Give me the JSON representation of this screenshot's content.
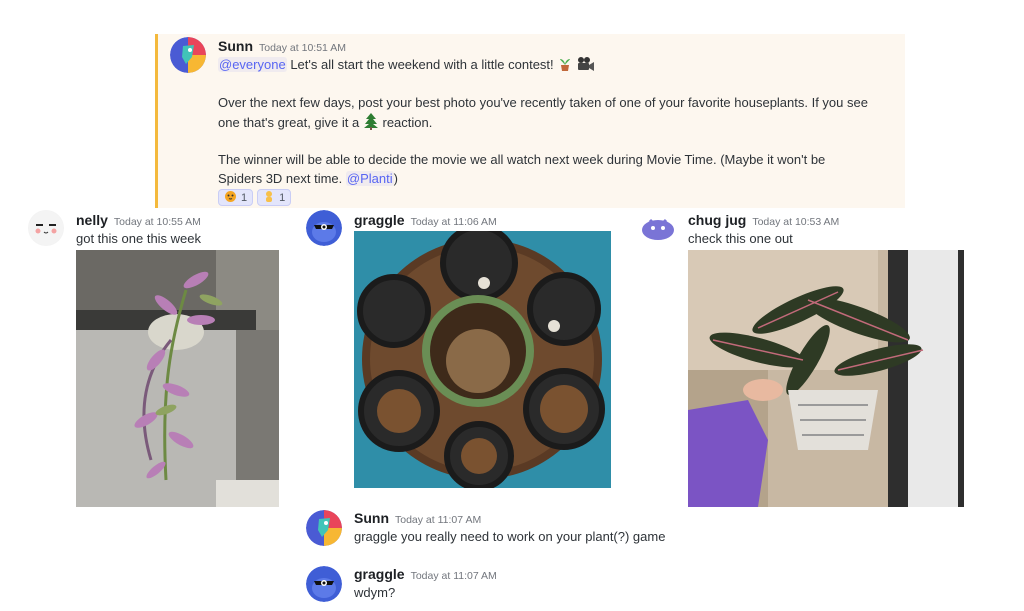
{
  "colors": {
    "accent": "#5865f2",
    "highlight_bg": "#fdf7ef",
    "highlight_bar": "#f4b93c"
  },
  "messages": {
    "sunn_main": {
      "author": "Sunn",
      "timestamp": "Today at 10:51 AM",
      "mention_everyone": "@everyone",
      "line1": "Let's all start the weekend with a little contest!",
      "line2": "Over the next few days, post your best photo you've recently taken of one of your favorite houseplants. If you see",
      "line3a": "one that's great, give it a",
      "line3b": "reaction.",
      "line4": "The winner will be able to decide the movie we all watch next week during Movie Time. (Maybe it won't be",
      "line5a": "Spiders 3D next time.",
      "line5_mention": "@Planti",
      "line5b": ")",
      "reactions": [
        {
          "emoji": "tiger-face",
          "count": "1"
        },
        {
          "emoji": "person-gesturing",
          "count": "1"
        }
      ]
    },
    "nelly": {
      "author": "nelly",
      "timestamp": "Today at 10:55 AM",
      "text": "got this one this week"
    },
    "graggle1": {
      "author": "graggle",
      "timestamp": "Today at 11:06 AM"
    },
    "chug": {
      "author": "chug jug",
      "timestamp": "Today at 10:53 AM",
      "text": "check this one out"
    },
    "sunn_reply": {
      "author": "Sunn",
      "timestamp": "Today at 11:07 AM",
      "text": "graggle you really need to work on your plant(?) game"
    },
    "graggle2": {
      "author": "graggle",
      "timestamp": "Today at 11:07 AM",
      "text": "wdym?"
    }
  },
  "icons": [
    "potted-plant-icon",
    "movie-camera-icon",
    "evergreen-tree-icon",
    "tiger-face-icon",
    "person-gesturing-icon"
  ]
}
